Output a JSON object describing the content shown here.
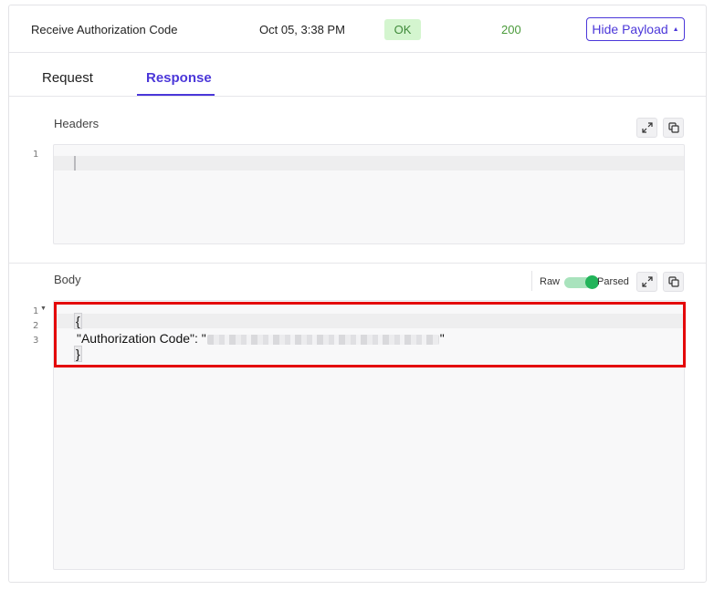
{
  "header": {
    "step_name": "Receive Authorization Code",
    "timestamp": "Oct 05, 3:38 PM",
    "status_text": "OK",
    "status_code": "200",
    "toggle_payload_label": "Hide Payload"
  },
  "tabs": [
    {
      "label": "Request",
      "active": false
    },
    {
      "label": "Response",
      "active": true
    }
  ],
  "headers_section": {
    "label": "Headers",
    "line_numbers": [
      "1"
    ]
  },
  "body_section": {
    "label": "Body",
    "view_toggle": {
      "left_label": "Raw",
      "right_label": "Parsed",
      "parsed_on": true
    },
    "line_numbers": [
      "1",
      "2",
      "3"
    ],
    "code": {
      "open_brace": "{",
      "key": "\"Authorization Code\"",
      "separator": ": ",
      "value_quote_open": "\"",
      "value_quote_close": "\"",
      "close_brace": "}"
    }
  },
  "icons": {
    "expand": "expand-icon",
    "copy": "copy-icon",
    "caret": "caret-up-icon",
    "fold": "fold-arrow-icon"
  },
  "colors": {
    "accent": "#4b37d9",
    "ok_bg": "#d4f5cf",
    "ok_text": "#3f8a3a",
    "toggle_on": "#22b45a",
    "highlight": "#e4080a"
  }
}
